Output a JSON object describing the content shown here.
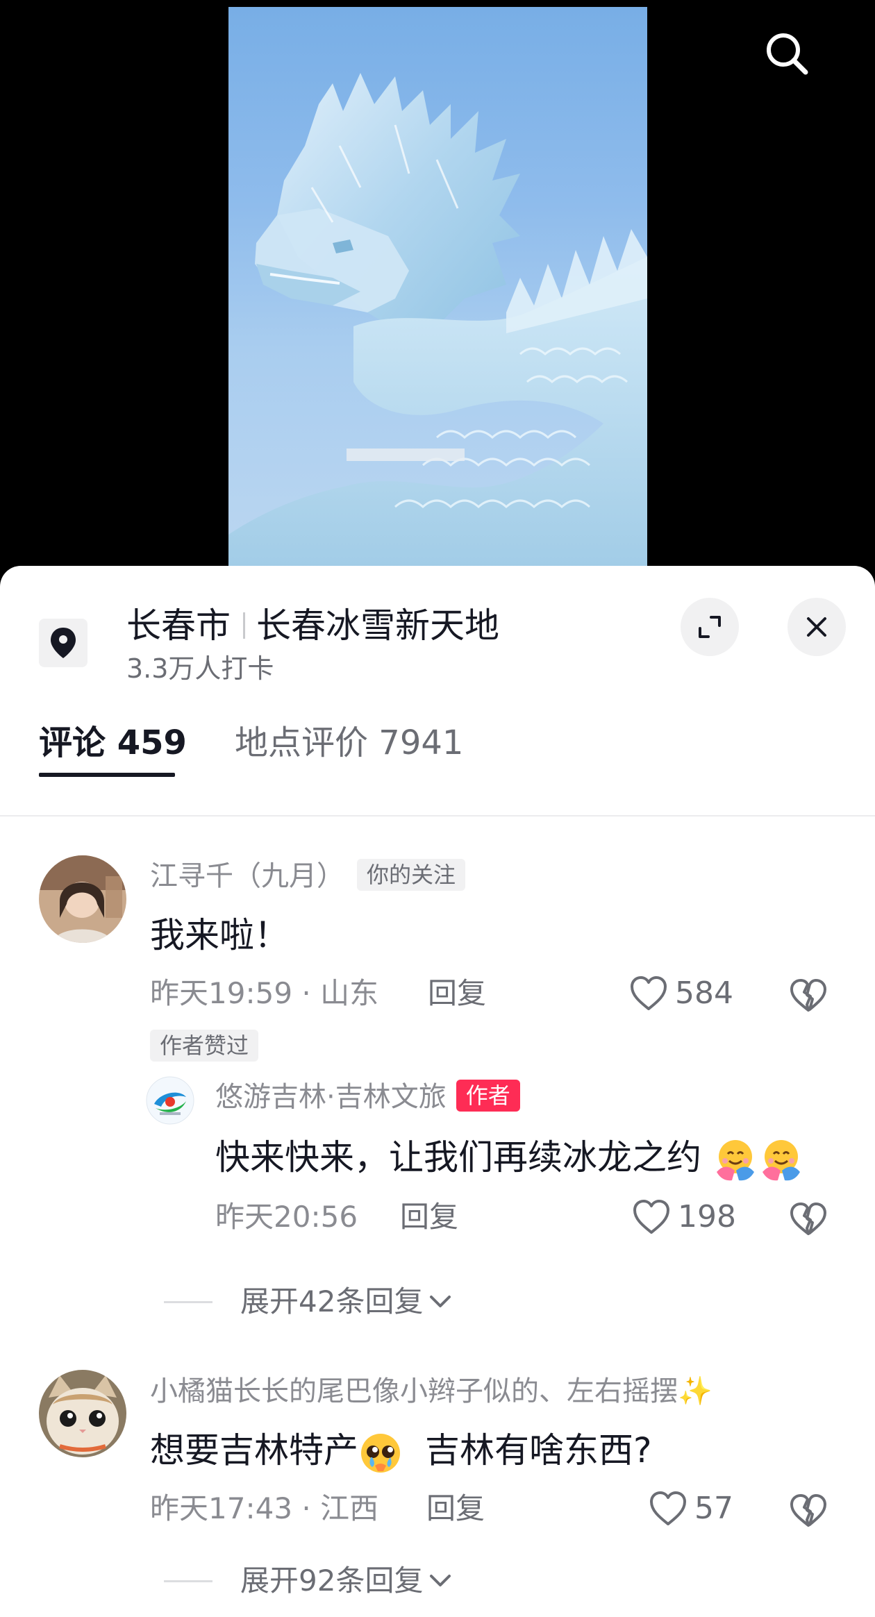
{
  "header": {
    "search_icon": "search-icon"
  },
  "location": {
    "city": "长春市",
    "place": "长春冰雪新天地",
    "checkins": "3.3万人打卡"
  },
  "tabs": [
    {
      "label": "评论",
      "count": "459",
      "active": true
    },
    {
      "label": "地点评价",
      "count": "7941",
      "active": false
    }
  ],
  "comments": [
    {
      "username": "江寻千（九月）",
      "badge": "你的关注",
      "text": "我来啦！",
      "time": "昨天19:59",
      "region": "山东",
      "reply_label": "回复",
      "likes": "584",
      "author_liked": "作者赞过",
      "reply": {
        "username": "悠游吉林·吉林文旅",
        "badge": "作者",
        "text": "快来快来，让我们再续冰龙之约",
        "time": "昨天20:56",
        "reply_label": "回复",
        "likes": "198"
      },
      "expand_label": "展开42条回复"
    },
    {
      "username": "小橘猫长长的尾巴像小辫子似的、左右摇摆✨",
      "text_part1": "想要吉林特产",
      "text_part2": "吉林有啥东西?",
      "time": "昨天17:43",
      "region": "江西",
      "reply_label": "回复",
      "likes": "57",
      "expand_label": "展开92条回复"
    }
  ],
  "colors": {
    "accent_red": "#fe2c55",
    "text_primary": "#161823",
    "text_secondary": "#8a8b91"
  }
}
